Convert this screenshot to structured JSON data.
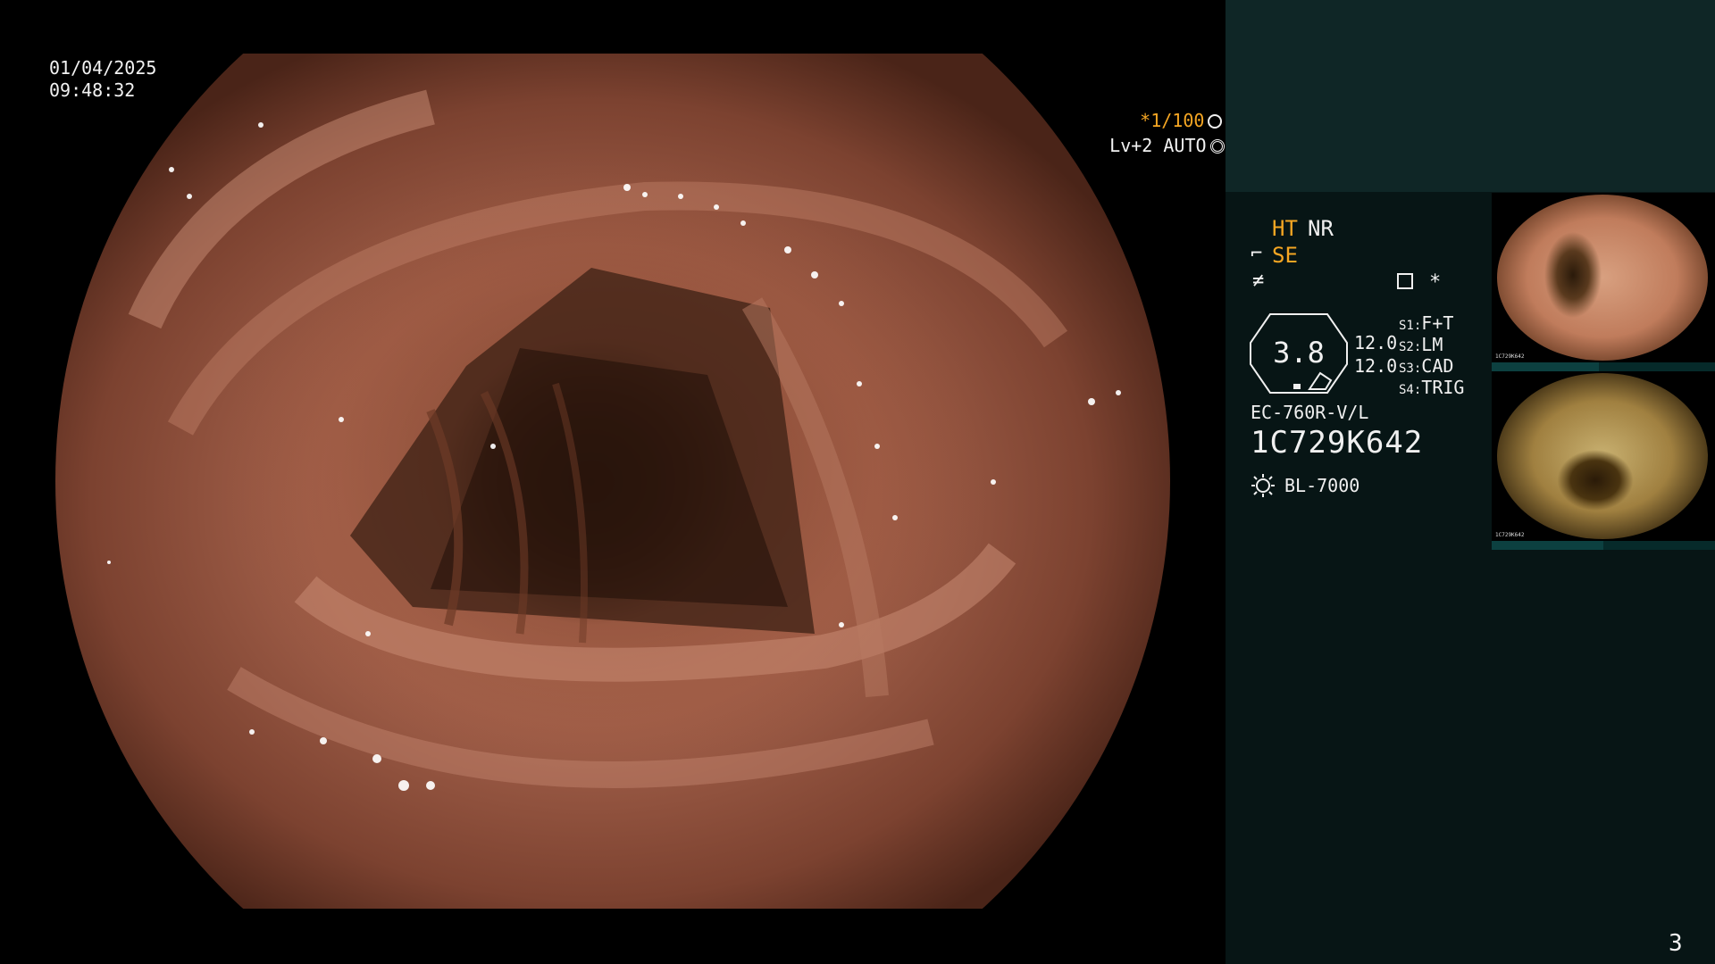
{
  "overlay": {
    "date": "01/04/2025",
    "time": "09:48:32",
    "shutter_speed": "*1/100",
    "enhancement": "Lv+2 AUTO"
  },
  "settings": {
    "ht": "HT",
    "nr": "NR",
    "se": "SE",
    "zoom_value": "3.8",
    "value_1": "12.0",
    "value_2": "12.0",
    "s1_key": "S1:",
    "s1_val": "F+T",
    "s2_key": "S2:",
    "s2_val": "LM",
    "s3_key": "S3:",
    "s3_val": "CAD",
    "s4_key": "S4:",
    "s4_val": "TRIG",
    "asterisk": "*",
    "scope_model": "EC-760R-V/L",
    "scope_serial": "1C729K642",
    "light_mode": "BL-7000"
  },
  "thumbnails": [
    {
      "serial": "1C729K642",
      "index": "2"
    },
    {
      "serial": "1C729K642",
      "index": "1"
    }
  ],
  "page_number": "3",
  "colors": {
    "accent": "#f5a623",
    "panel_dark": "#071515",
    "panel_top": "#0f2626"
  }
}
